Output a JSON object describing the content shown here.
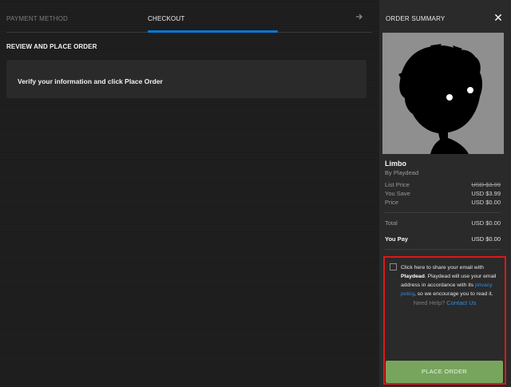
{
  "tabs": {
    "payment": "PAYMENT METHOD",
    "checkout": "CHECKOUT",
    "arrow_icon": "forward-arrow-icon"
  },
  "review": {
    "title": "REVIEW AND PLACE ORDER",
    "instruction": "Verify your information and click Place Order"
  },
  "summary": {
    "title": "ORDER SUMMARY",
    "close_icon": "close-icon",
    "game": {
      "title": "Limbo",
      "developer": "By Playdead"
    },
    "prices": {
      "list_price_label": "List Price",
      "list_price_value": "USD $3.99",
      "you_save_label": "You Save",
      "you_save_value": "USD $3.99",
      "price_label": "Price",
      "price_value": "USD $0.00",
      "total_label": "Total",
      "total_value": "USD $0.00",
      "you_pay_label": "You Pay",
      "you_pay_value": "USD $0.00"
    },
    "consent": {
      "text_1": "Click here to share your email with ",
      "publisher": "Playdead",
      "text_2": ". Playdead will use your email address in accordance with its ",
      "privacy_link": "privacy policy",
      "text_3": ", so we encourage you to read it."
    },
    "help": {
      "text": "Need Help?",
      "link": "Contact Us"
    },
    "place_order": "PLACE ORDER"
  },
  "colors": {
    "accent_blue": "#0b76d6",
    "link_blue": "#2d8fe6",
    "button_green": "#77a55d",
    "highlight_red": "#e0161a"
  }
}
